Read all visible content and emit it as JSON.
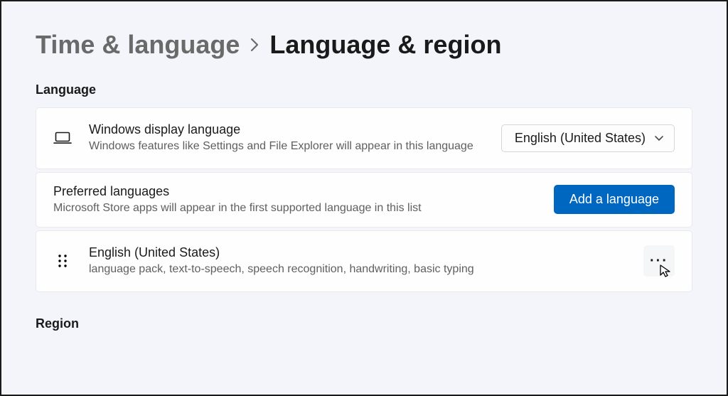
{
  "breadcrumb": {
    "parent": "Time & language",
    "current": "Language & region"
  },
  "sections": {
    "language_heading": "Language",
    "region_heading": "Region"
  },
  "display_language": {
    "title": "Windows display language",
    "description": "Windows features like Settings and File Explorer will appear in this language",
    "selected": "English (United States)"
  },
  "preferred": {
    "title": "Preferred languages",
    "description": "Microsoft Store apps will appear in the first supported language in this list",
    "add_button": "Add a language"
  },
  "language_item": {
    "name": "English (United States)",
    "features": "language pack, text-to-speech, speech recognition, handwriting, basic typing"
  }
}
